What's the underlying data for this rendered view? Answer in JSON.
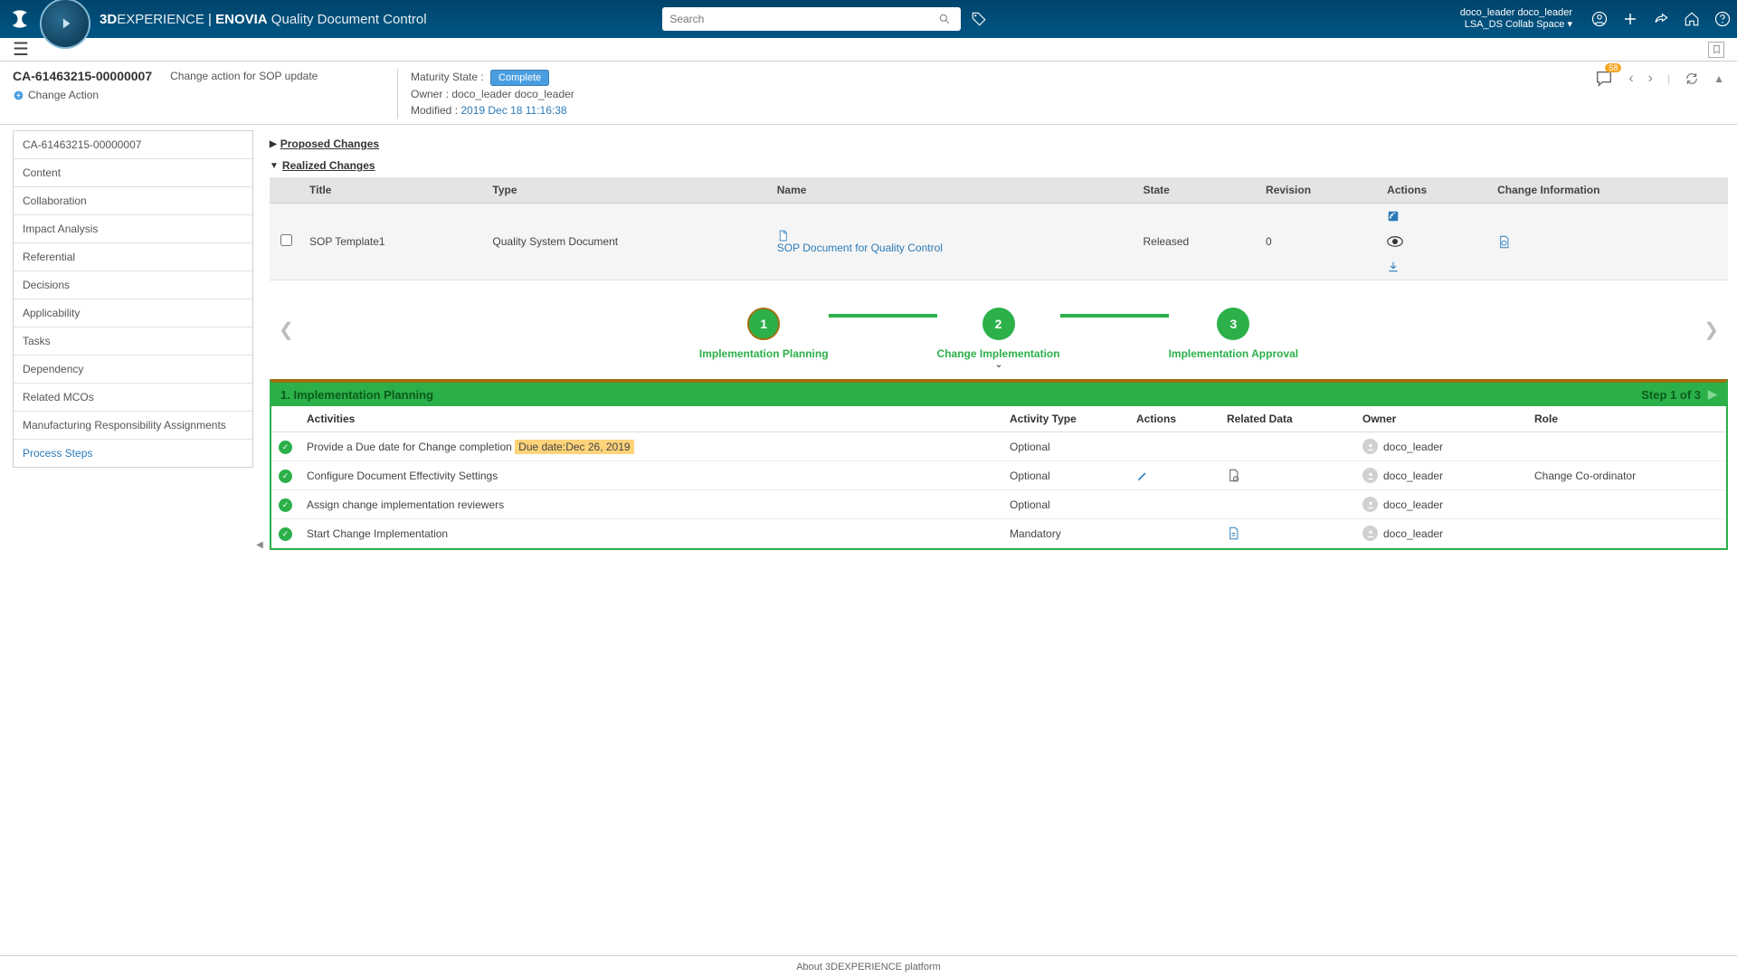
{
  "ribbon": {
    "brand_bold": "3D",
    "brand_rest": "EXPERIENCE",
    "brand_sep": " | ",
    "brand_app_bold": "ENOVIA",
    "brand_app": " Quality Document Control",
    "search_placeholder": "Search",
    "user_name": "doco_leader doco_leader",
    "collab_space": "LSA_DS Collab Space"
  },
  "header": {
    "id": "CA-61463215-00000007",
    "subtitle": "Change action for SOP update",
    "type_label": "Change Action",
    "maturity_label": "Maturity State :",
    "maturity_badge": "Complete",
    "owner_label": "Owner : doco_leader doco_leader",
    "modified_label": "Modified : ",
    "modified_date": "2019 Dec 18 11:16:38",
    "comment_count": "58"
  },
  "sidebar": {
    "items": [
      {
        "label": "CA-61463215-00000007"
      },
      {
        "label": "Content"
      },
      {
        "label": "Collaboration"
      },
      {
        "label": "Impact Analysis"
      },
      {
        "label": "Referential"
      },
      {
        "label": "Decisions"
      },
      {
        "label": "Applicability"
      },
      {
        "label": "Tasks"
      },
      {
        "label": "Dependency"
      },
      {
        "label": "Related MCOs"
      },
      {
        "label": "Manufacturing Responsibility Assignments"
      },
      {
        "label": "Process Steps"
      }
    ]
  },
  "sections": {
    "proposed": "Proposed Changes",
    "realized": "Realized Changes"
  },
  "rc_table": {
    "headers": {
      "title": "Title",
      "type": "Type",
      "name": "Name",
      "state": "State",
      "revision": "Revision",
      "actions": "Actions",
      "change_info": "Change Information"
    },
    "row": {
      "title": "SOP Template1",
      "type": "Quality System Document",
      "name": "SOP Document for Quality Control",
      "state": "Released",
      "revision": "0"
    }
  },
  "stepper": {
    "s1": {
      "num": "1",
      "label": "Implementation Planning"
    },
    "s2": {
      "num": "2",
      "label": "Change Implementation"
    },
    "s3": {
      "num": "3",
      "label": "Implementation Approval"
    }
  },
  "stage": {
    "title": "1. Implementation Planning",
    "step_of": "Step 1 of 3",
    "headers": {
      "activities": "Activities",
      "activity_type": "Activity Type",
      "actions": "Actions",
      "related_data": "Related Data",
      "owner": "Owner",
      "role": "Role"
    },
    "rows": [
      {
        "activity": "Provide a Due date for Change completion",
        "due": "Due date:Dec 26, 2019",
        "type": "Optional",
        "owner": "doco_leader",
        "role": "",
        "has_edit": false,
        "has_related": false
      },
      {
        "activity": "Configure Document Effectivity Settings",
        "due": "",
        "type": "Optional",
        "owner": "doco_leader",
        "role": "Change Co-ordinator",
        "has_edit": true,
        "has_related": true
      },
      {
        "activity": "Assign change implementation reviewers",
        "due": "",
        "type": "Optional",
        "owner": "doco_leader",
        "role": "",
        "has_edit": false,
        "has_related": false
      },
      {
        "activity": "Start Change Implementation",
        "due": "",
        "type": "Mandatory",
        "owner": "doco_leader",
        "role": "",
        "has_edit": false,
        "has_related": true
      }
    ]
  },
  "footer": {
    "about": "About 3DEXPERIENCE platform"
  }
}
